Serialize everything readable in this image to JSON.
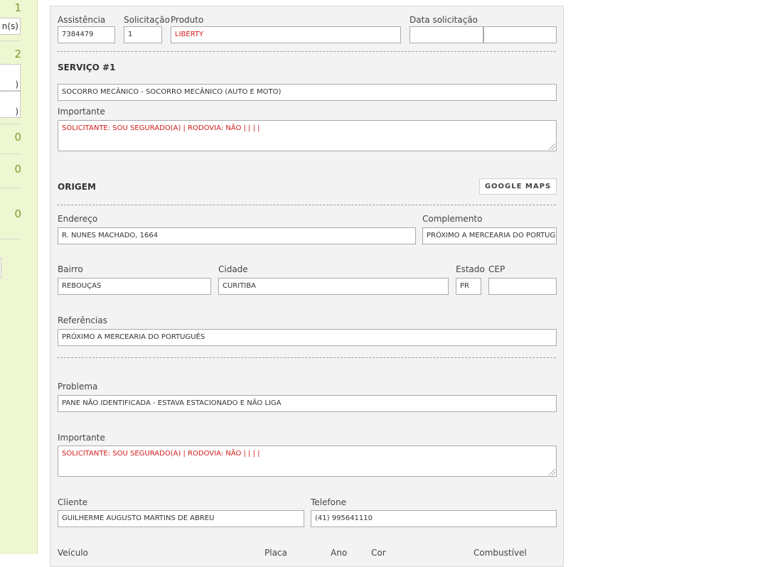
{
  "sidebar": {
    "counts": [
      "1",
      "2",
      "0",
      "0",
      "0"
    ],
    "fields": [
      "n(s)",
      ")",
      ")"
    ]
  },
  "form": {
    "assistencia": {
      "label": "Assistência",
      "value": "7384479"
    },
    "solicitacao": {
      "label": "Solicitação",
      "value": "1"
    },
    "produto": {
      "label": "Produto",
      "value": "LIBERTY"
    },
    "data_solicitacao": {
      "label": "Data solicitação",
      "date": "",
      "time": ""
    },
    "servico": {
      "heading": "SERVIÇO #1",
      "value": "SOCORRO MECÂNICO - SOCORRO MECÂNICO (AUTO E MOTO)",
      "importante_label": "Importante",
      "importante_value": "SOLICITANTE: SOU SEGURADO(A) | RODOVIA: NÃO |  |  |  |"
    },
    "origem": {
      "heading": "ORIGEM",
      "maps_button": "GOOGLE MAPS",
      "endereco_label": "Endereço",
      "endereco_value": "R. NUNES MACHADO, 1664",
      "complemento_label": "Complemento",
      "complemento_value": "PRÓXIMO A MERCEARIA DO PORTUGUÊS",
      "bairro_label": "Bairro",
      "bairro_value": "REBOUÇAS",
      "cidade_label": "Cidade",
      "cidade_value": "CURITIBA",
      "estado_label": "Estado",
      "estado_value": "PR",
      "cep_label": "CEP",
      "cep_value": "",
      "referencias_label": "Referências",
      "referencias_value": "PRÓXIMO A MERCEARIA DO PORTUGUÊS"
    },
    "problema": {
      "label": "Problema",
      "value": "PANE NÃO IDENTIFICADA - ESTAVA ESTACIONADO E NÃO LIGA",
      "importante_label": "Importante",
      "importante_value": "SOLICITANTE: SOU SEGURADO(A) | RODOVIA: NÃO |  |  |  |"
    },
    "cliente": {
      "label": "Cliente",
      "value": "GUILHERME AUGUSTO MARTINS DE ABREU"
    },
    "telefone": {
      "label": "Telefone",
      "value": "(41) 995641110"
    },
    "bottom_labels": {
      "veiculo": "Veículo",
      "placa": "Placa",
      "ano": "Ano",
      "cor": "Cor",
      "combustivel": "Combustível"
    }
  }
}
